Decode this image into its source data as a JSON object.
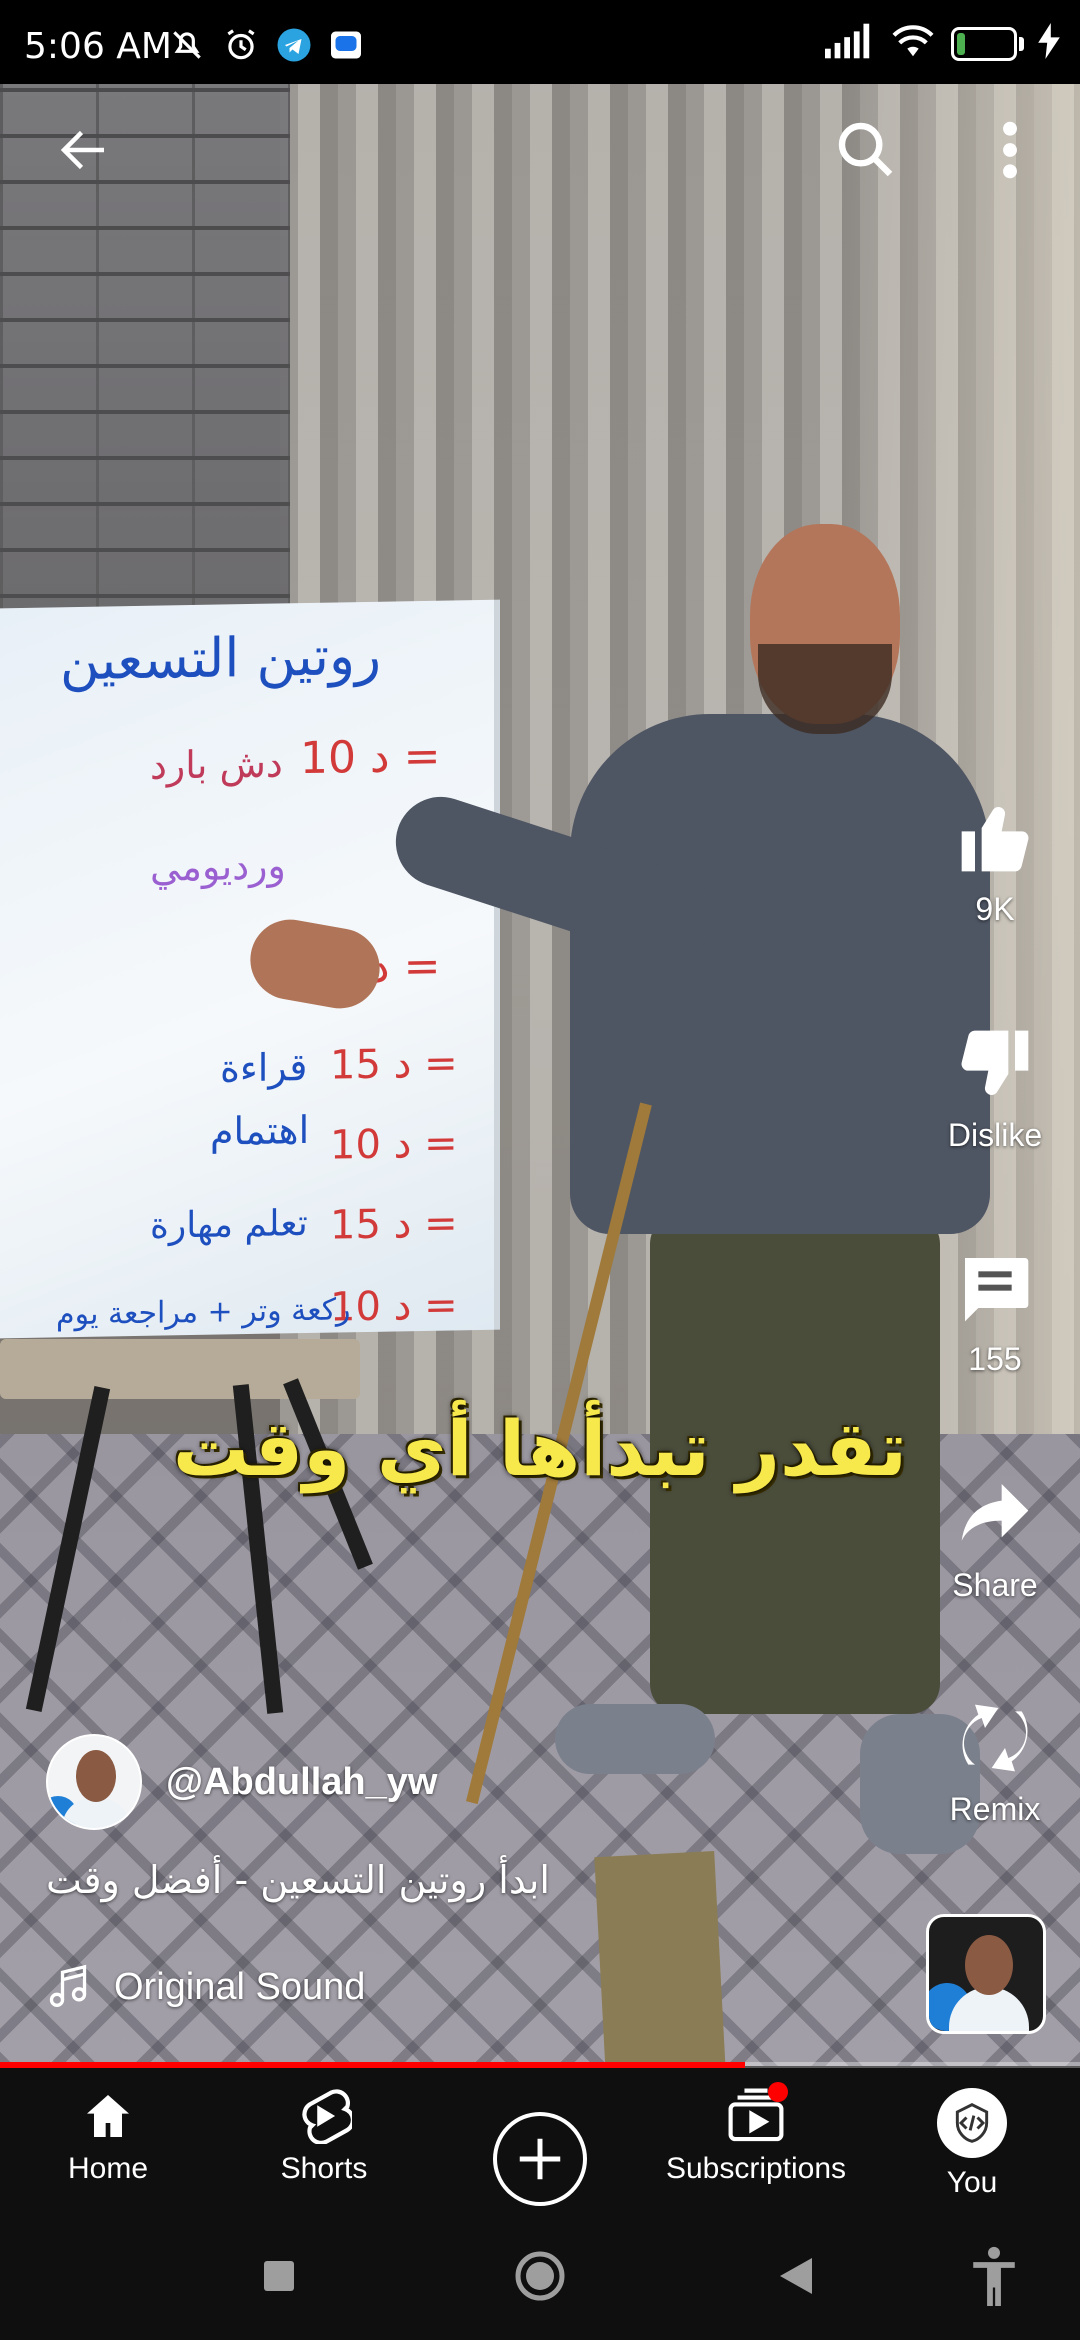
{
  "status_bar": {
    "time": "5:06 AM",
    "battery": "14",
    "battery_level": 0.14,
    "icons": [
      "mute-icon",
      "alarm-icon",
      "telegram-icon",
      "message-icon",
      "signal-icon",
      "wifi-icon",
      "battery-icon",
      "charging-icon"
    ]
  },
  "video": {
    "whiteboard": {
      "title": "روتين التسعين",
      "lines": [
        {
          "minutes": "10 د =",
          "task": "دش بارد"
        },
        {
          "minutes": "",
          "task": "ورديومي"
        },
        {
          "minutes": "20 د =",
          "task": ""
        },
        {
          "minutes": "15 د =",
          "task": "قراءة"
        },
        {
          "minutes": "10 د =",
          "task": "اهتمام"
        },
        {
          "minutes": "15 د =",
          "task": "تعلم مهارة"
        },
        {
          "minutes": "10 د =",
          "task": "ركعة وتر + مراجعة يوم"
        }
      ]
    },
    "caption": "تقدر تبدأها أي وقت",
    "progress_fraction": 0.69
  },
  "actions": {
    "like_count": "9K",
    "dislike_label": "Dislike",
    "comment_count": "155",
    "share_label": "Share",
    "remix_label": "Remix"
  },
  "channel": {
    "handle": "@Abdullah_yw",
    "title": "ابدأ روتين التسعين - أفضل وقت",
    "sound": "Original Sound"
  },
  "bottom_nav": {
    "items": [
      {
        "label": "Home",
        "icon": "home-icon"
      },
      {
        "label": "Shorts",
        "icon": "shorts-icon"
      },
      {
        "label": "",
        "icon": "create-icon"
      },
      {
        "label": "Subscriptions",
        "icon": "subscriptions-icon"
      },
      {
        "label": "You",
        "icon": "you-avatar"
      }
    ]
  },
  "colors": {
    "accent": "#ff0000",
    "caption": "#f7e84b",
    "nav_bg": "#0f0f0f"
  }
}
